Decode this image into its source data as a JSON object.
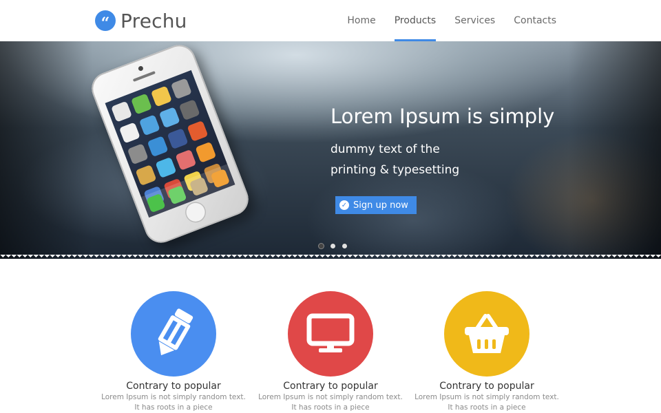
{
  "brand": {
    "name": "Prechu",
    "mark": "“"
  },
  "nav": {
    "items": [
      {
        "label": "Home",
        "active": false
      },
      {
        "label": "Products",
        "active": true
      },
      {
        "label": "Services",
        "active": false
      },
      {
        "label": "Contacts",
        "active": false
      }
    ]
  },
  "hero": {
    "title": "Lorem Ipsum is simply",
    "line1": "dummy text of the",
    "line2": "printing & typesetting",
    "cta": "Sign up now",
    "slides_total": 3,
    "slide_active": 1
  },
  "features": [
    {
      "icon": "pencil-icon",
      "color": "#4a8ef0",
      "title": "Contrary to popular",
      "text1": "Lorem Ipsum is not simply random text.",
      "text2": "It has roots in a piece"
    },
    {
      "icon": "monitor-icon",
      "color": "#e04848",
      "title": "Contrary to popular",
      "text1": "Lorem Ipsum is not simply random text.",
      "text2": "It has roots in a piece"
    },
    {
      "icon": "basket-icon",
      "color": "#f0b919",
      "title": "Contrary to popular",
      "text1": "Lorem Ipsum is not simply random text.",
      "text2": "It has roots in a piece"
    }
  ],
  "colors": {
    "accent": "#3f8ae6"
  }
}
